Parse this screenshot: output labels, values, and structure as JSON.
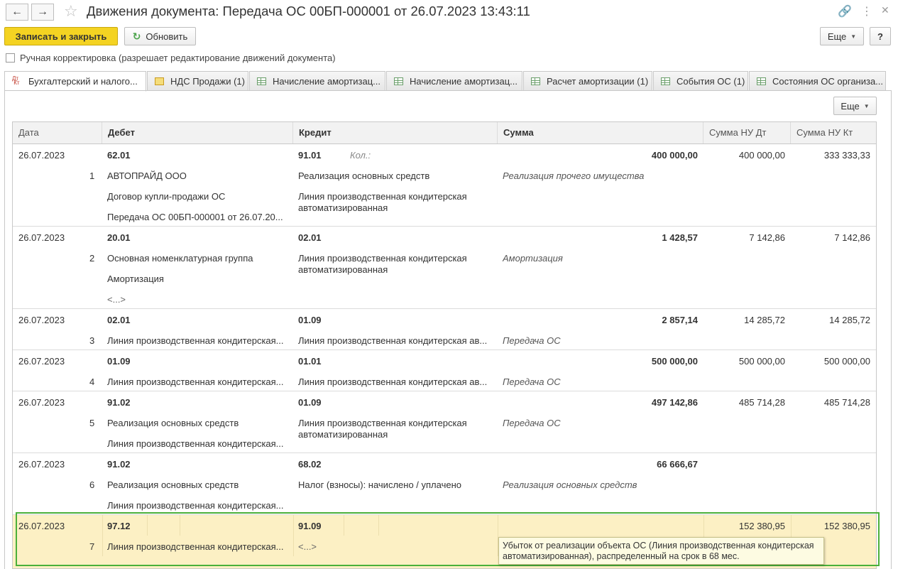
{
  "window": {
    "title": "Движения документа: Передача ОС 00БП-000001 от 26.07.2023 13:43:11",
    "back_icon": "arrow-left-icon",
    "forward_icon": "arrow-right-icon",
    "favorite_icon": "star-icon",
    "link_icon": "link-icon",
    "menu_icon": "vertical-dots-icon",
    "close_icon": "close-icon"
  },
  "toolbar": {
    "save_close": "Записать и закрыть",
    "refresh": "Обновить",
    "more": "Еще",
    "help": "?"
  },
  "manual_edit": {
    "label": "Ручная корректировка (разрешает редактирование движений документа)",
    "checked": false
  },
  "tabs": [
    {
      "label": "Бухгалтерский и налого...",
      "active": true
    },
    {
      "label": "НДС Продажи (1)"
    },
    {
      "label": "Начисление амортизац..."
    },
    {
      "label": "Начисление амортизац..."
    },
    {
      "label": "Расчет амортизации (1)"
    },
    {
      "label": "События ОС (1)"
    },
    {
      "label": "Состояния ОС организа..."
    }
  ],
  "panel": {
    "more": "Еще"
  },
  "table": {
    "columns": {
      "date": "Дата",
      "debit": "Дебет",
      "credit": "Кредит",
      "sum": "Сумма",
      "sum_nu_dt": "Сумма НУ Дт",
      "sum_nu_kt": "Сумма НУ Кт"
    },
    "rows": [
      {
        "date": "26.07.2023",
        "num": "1",
        "debit": {
          "account": "62.01",
          "sub": [
            "АВТОПРАЙД ООО",
            "Договор купли-продажи ОС",
            "Передача ОС 00БП-000001 от 26.07.20..."
          ]
        },
        "credit": {
          "account": "91.01",
          "qty_label": "Кол.:",
          "sub": [
            "Реализация основных средств",
            "Линия производственная кондитерская автоматизированная"
          ]
        },
        "sum": "400 000,00",
        "content": "Реализация прочего имущества",
        "sum_nu_dt": "400 000,00",
        "sum_nu_kt": "333 333,33"
      },
      {
        "date": "26.07.2023",
        "num": "2",
        "debit": {
          "account": "20.01",
          "sub": [
            "Основная номенклатурная группа",
            "Амортизация",
            "<...>"
          ]
        },
        "credit": {
          "account": "02.01",
          "sub": [
            "Линия производственная кондитерская автоматизированная"
          ]
        },
        "sum": "1 428,57",
        "content": "Амортизация",
        "sum_nu_dt": "7 142,86",
        "sum_nu_kt": "7 142,86"
      },
      {
        "date": "26.07.2023",
        "num": "3",
        "debit": {
          "account": "02.01",
          "sub": [
            "Линия производственная кондитерская..."
          ]
        },
        "credit": {
          "account": "01.09",
          "sub": [
            "Линия производственная кондитерская ав..."
          ]
        },
        "sum": "2 857,14",
        "content": "Передача ОС",
        "sum_nu_dt": "14 285,72",
        "sum_nu_kt": "14 285,72"
      },
      {
        "date": "26.07.2023",
        "num": "4",
        "debit": {
          "account": "01.09",
          "sub": [
            "Линия производственная кондитерская..."
          ]
        },
        "credit": {
          "account": "01.01",
          "sub": [
            "Линия производственная кондитерская ав..."
          ]
        },
        "sum": "500 000,00",
        "content": "Передача ОС",
        "sum_nu_dt": "500 000,00",
        "sum_nu_kt": "500 000,00"
      },
      {
        "date": "26.07.2023",
        "num": "5",
        "debit": {
          "account": "91.02",
          "sub": [
            "Реализация основных средств",
            "Линия производственная кондитерская..."
          ]
        },
        "credit": {
          "account": "01.09",
          "sub": [
            "Линия производственная кондитерская автоматизированная"
          ]
        },
        "sum": "497 142,86",
        "content": "Передача ОС",
        "sum_nu_dt": "485 714,28",
        "sum_nu_kt": "485 714,28"
      },
      {
        "date": "26.07.2023",
        "num": "6",
        "debit": {
          "account": "91.02",
          "sub": [
            "Реализация основных средств",
            "Линия производственная кондитерская..."
          ]
        },
        "credit": {
          "account": "68.02",
          "sub": [
            "Налог (взносы): начислено / уплачено"
          ]
        },
        "sum": "66 666,67",
        "content": "Реализация основных средств",
        "sum_nu_dt": "",
        "sum_nu_kt": ""
      },
      {
        "date": "26.07.2023",
        "num": "7",
        "debit": {
          "account": "97.12",
          "sub": [
            "Линия производственная кондитерская..."
          ]
        },
        "credit": {
          "account": "91.09",
          "sub": [
            "<...>"
          ]
        },
        "sum": "",
        "content": "",
        "sum_nu_dt": "152 380,95",
        "sum_nu_kt": "152 380,95"
      }
    ]
  },
  "tooltip": "Убыток от реализации объекта ОС (Линия производственная кондитерская автоматизированная), распределенный на срок в 68 мес.",
  "colors": {
    "accent": "#f4d322",
    "selection": "#fcf0c4",
    "selection_border": "#4ab03a"
  }
}
